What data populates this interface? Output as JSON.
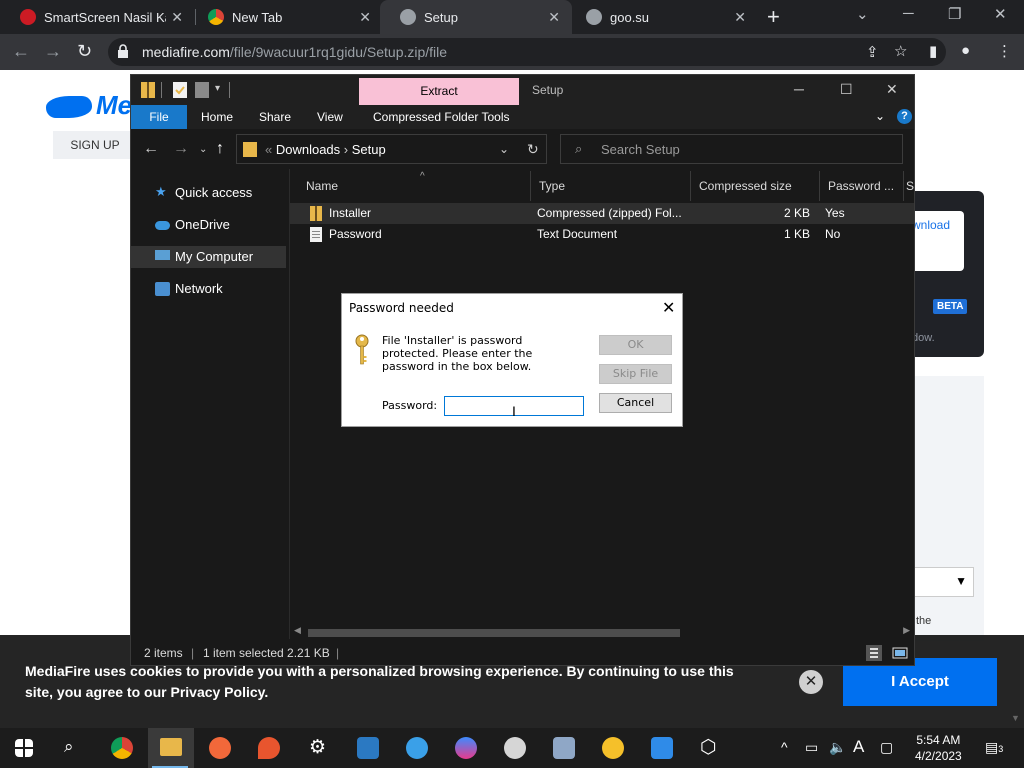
{
  "browser": {
    "tabs": [
      {
        "label": "SmartScreen Nasil Kap",
        "icon": "opera-icon"
      },
      {
        "label": "New Tab",
        "icon": "chrome-icon"
      },
      {
        "label": "Setup",
        "icon": "globe-icon"
      },
      {
        "label": "goo.su",
        "icon": "globe-icon"
      }
    ],
    "url_host": "mediafire.com",
    "url_path": "/file/9wacuur1rq1gidu/Setup.zip/file"
  },
  "webpage": {
    "logo": "Me",
    "signup": "SIGN UP",
    "download_partial": "wnload",
    "beta": "BETA",
    "window_partial": "dow.",
    "the_partial": "the",
    "cookie_text": "MediaFire uses cookies to provide you with a personalized browsing experience. By continuing to use this site, you agree to our Privacy Policy.",
    "cookie_accept": "I Accept"
  },
  "explorer": {
    "ribbon_context_tab": "Extract",
    "title": "Setup",
    "ribbon_tabs": [
      "File",
      "Home",
      "Share",
      "View",
      "Compressed Folder Tools"
    ],
    "breadcrumb": [
      "Downloads",
      "Setup"
    ],
    "search_placeholder": "Search Setup",
    "nav_items": [
      {
        "label": "Quick access",
        "icon": "star-icon"
      },
      {
        "label": "OneDrive",
        "icon": "cloud-icon"
      },
      {
        "label": "My Computer",
        "icon": "computer-icon",
        "selected": true
      },
      {
        "label": "Network",
        "icon": "network-icon"
      }
    ],
    "columns": [
      "Name",
      "Type",
      "Compressed size",
      "Password ...",
      "Si"
    ],
    "files": [
      {
        "name": "Installer",
        "type": "Compressed (zipped) Fol...",
        "size": "2 KB",
        "password": "Yes",
        "icon": "zip-folder-icon"
      },
      {
        "name": "Password",
        "type": "Text Document",
        "size": "1 KB",
        "password": "No",
        "icon": "text-file-icon"
      }
    ],
    "status": {
      "items": "2 items",
      "selected": "1 item selected 2.21 KB"
    }
  },
  "dialog": {
    "title": "Password needed",
    "message": "File 'Installer' is password protected. Please enter the password in the box below.",
    "password_label": "Password:",
    "password_value": "",
    "ok": "OK",
    "skip": "Skip File",
    "cancel": "Cancel"
  },
  "taskbar": {
    "time": "5:54 AM",
    "date": "4/2/2023",
    "notification_count": "3"
  },
  "colors": {
    "accent_blue": "#1979ca",
    "mediafire_blue": "#0070f0",
    "extract_pink": "#f9c1d6"
  }
}
